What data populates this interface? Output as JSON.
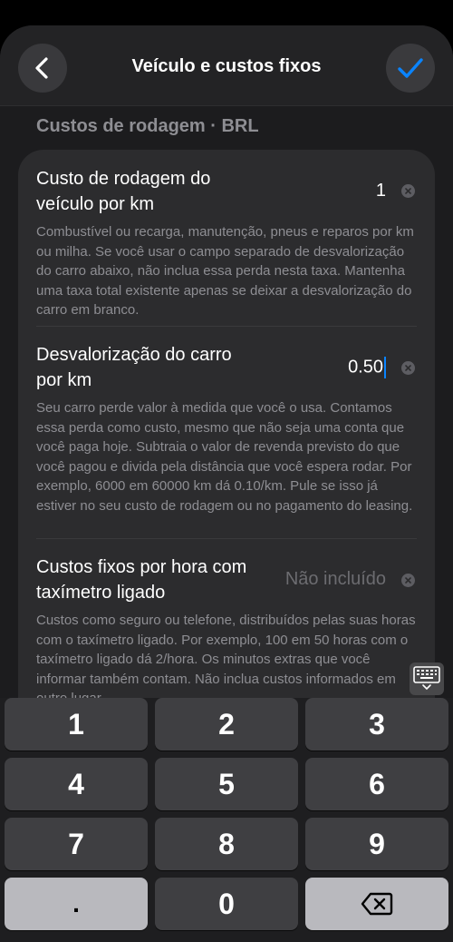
{
  "header": {
    "title": "Veículo e custos fixos"
  },
  "section": {
    "title": "Custos de rodagem · BRL"
  },
  "rows": [
    {
      "label": "Custo de rodagem do veículo por km",
      "value": "1",
      "description": "Combustível ou recarga, manutenção, pneus e reparos por km ou milha. Se você usar o campo separado de desvalorização do carro abaixo, não inclua essa perda nesta taxa. Mantenha uma taxa total existente apenas se deixar a desvalorização do carro em branco."
    },
    {
      "label": "Desvalorização do carro por km",
      "value": "0.50",
      "description": "Seu carro perde valor à medida que você o usa. Contamos essa perda como custo, mesmo que não seja uma conta que você paga hoje. Subtraia o valor de revenda previsto do que você pagou e divida pela distância que você espera rodar. Por exemplo, 6000 em 60000 km dá 0.10/km. Pule se isso já estiver no seu custo de rodagem ou no pagamento do leasing."
    },
    {
      "label": "Custos fixos por hora com taxímetro ligado",
      "placeholder": "Não incluído",
      "description": "Custos como seguro ou telefone, distribuídos pelas suas horas com o taxímetro ligado. Por exemplo, 100 em 50 horas com o taxímetro ligado dá 2/hora. Os minutos extras que você informar também contam. Não inclua custos informados em outro lugar."
    }
  ],
  "keyboard": {
    "keys": [
      "1",
      "2",
      "3",
      "4",
      "5",
      "6",
      "7",
      "8",
      "9",
      ".",
      "0"
    ]
  },
  "icons": {
    "back": "chevron-left-icon",
    "confirm": "checkmark-icon",
    "clear": "clear-x-icon",
    "keyboard_toggle": "keyboard-dismiss-icon",
    "delete": "backspace-icon"
  },
  "colors": {
    "accent": "#0a84ff"
  }
}
